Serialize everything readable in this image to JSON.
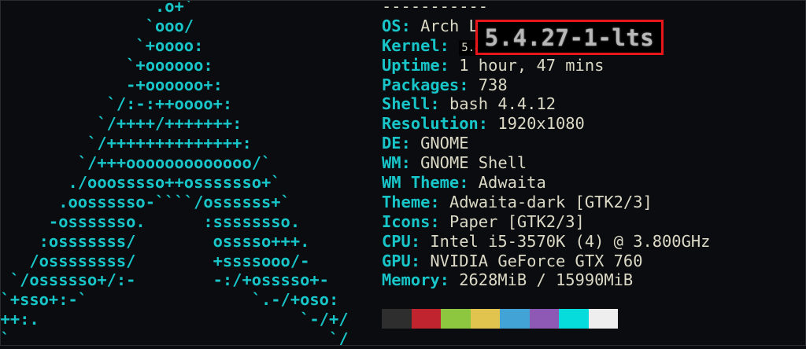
{
  "ascii_logo": [
    "                  .o+`",
    "                 `ooo/",
    "                `+oooo:",
    "               `+oooooo:",
    "               -+oooooo+:",
    "             `/:-:++oooo+:",
    "            `/++++/+++++++:",
    "           `/++++++++++++++:",
    "          `/+++ooooooooooooo/`",
    "         ./ooosssso++osssssso+`",
    "        .oossssso-````/ossssss+`",
    "       -osssssso.      :ssssssso.",
    "      :osssssss/        osssso+++.",
    "     /ossssssss/        +ssssooo/-",
    "   `/ossssso+/:-        -:/+osssso+-",
    "  `+sso+:-`                 `.-/+oso:",
    "  ++:.                           `-/+/",
    "  `                                 `/"
  ],
  "separator": "-----------",
  "info": [
    {
      "label": "OS",
      "value": "Arch L"
    },
    {
      "label": "Kernel",
      "value": "5.4"
    },
    {
      "label": "Uptime",
      "value": "1 hour, 47 mins"
    },
    {
      "label": "Packages",
      "value": "738"
    },
    {
      "label": "Shell",
      "value": "bash 4.4.12"
    },
    {
      "label": "Resolution",
      "value": "1920x1080"
    },
    {
      "label": "DE",
      "value": "GNOME"
    },
    {
      "label": "WM",
      "value": "GNOME Shell"
    },
    {
      "label": "WM Theme",
      "value": "Adwaita"
    },
    {
      "label": "Theme",
      "value": "Adwaita-dark [GTK2/3]"
    },
    {
      "label": "Icons",
      "value": "Paper [GTK2/3]"
    },
    {
      "label": "CPU",
      "value": "Intel i5-3570K (4) @ 3.800GHz"
    },
    {
      "label": "GPU",
      "value": "NVIDIA GeForce GTX 760"
    },
    {
      "label": "Memory",
      "value": "2628MiB / 15990MiB"
    }
  ],
  "kernel_highlight": "5.4.27-1-lts",
  "palette": [
    "#2e2e2e",
    "#c0252f",
    "#8dc63f",
    "#e0c44d",
    "#41a3d6",
    "#8e58b5",
    "#07dcdc",
    "#eeeeee"
  ],
  "colors": {
    "accent": "#18c6c9",
    "text": "#dcd9c6",
    "highlight_border": "#e8151b",
    "background": "#0a0c0f"
  }
}
